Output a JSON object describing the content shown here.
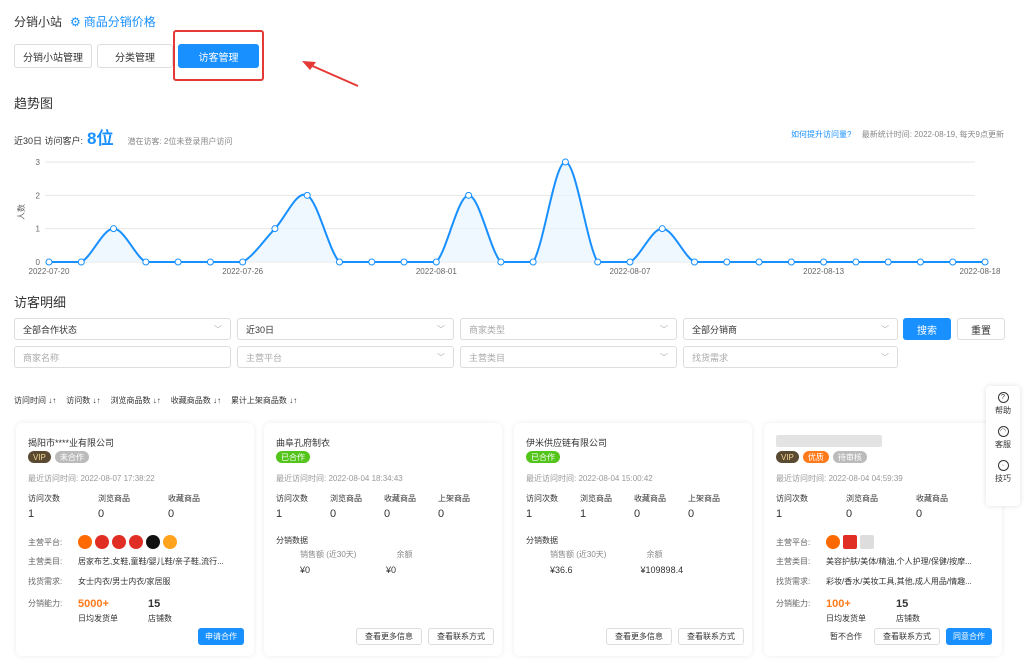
{
  "header": {
    "site": "分销小站",
    "price_link": "商品分销价格"
  },
  "tabs": [
    {
      "label": "分销小站管理"
    },
    {
      "label": "分类管理"
    },
    {
      "label": "访客管理"
    }
  ],
  "trend": {
    "title": "趋势图",
    "summary_label": "近30日 访问客户:",
    "summary_value": "8位",
    "potential": "潜在访客: 2位未登录用户访问",
    "help_link": "如何提升访问量?",
    "updated": "最新统计时间: 2022-08-19, 每天9点更新"
  },
  "chart_data": {
    "type": "area",
    "ylabel": "人数",
    "ylim": [
      0,
      3
    ],
    "yticks": [
      "0",
      "1",
      "2",
      "3"
    ],
    "x": [
      "2022-07-20",
      "2022-07-21",
      "2022-07-22",
      "2022-07-23",
      "2022-07-24",
      "2022-07-25",
      "2022-07-26",
      "2022-07-27",
      "2022-07-28",
      "2022-07-29",
      "2022-07-30",
      "2022-07-31",
      "2022-08-01",
      "2022-08-02",
      "2022-08-03",
      "2022-08-04",
      "2022-08-05",
      "2022-08-06",
      "2022-08-07",
      "2022-08-08",
      "2022-08-09",
      "2022-08-10",
      "2022-08-11",
      "2022-08-12",
      "2022-08-13",
      "2022-08-14",
      "2022-08-15",
      "2022-08-16",
      "2022-08-17",
      "2022-08-18"
    ],
    "xticks": [
      "2022-07-20",
      "2022-07-26",
      "2022-08-01",
      "2022-08-07",
      "2022-08-13",
      "2022-08-18"
    ],
    "values": [
      0,
      0,
      1,
      0,
      0,
      0,
      0,
      1,
      2,
      0,
      0,
      0,
      0,
      2,
      0,
      0,
      3,
      0,
      0,
      1,
      0,
      0,
      0,
      0,
      0,
      0,
      0,
      0,
      0,
      0
    ],
    "line_color": "#1890ff"
  },
  "detail": {
    "title": "访客明细"
  },
  "filters": {
    "row1": [
      "全部合作状态",
      "近30日",
      "商家类型",
      "全部分销商"
    ],
    "row2": [
      "商家名称",
      "主营平台",
      "主营类目",
      "找货需求"
    ],
    "search": "搜索",
    "reset": "重置"
  },
  "sorts": [
    "访问时间",
    "访问数",
    "浏览商品数",
    "收藏商品数",
    "累计上架商品数"
  ],
  "sidebar": [
    "帮助",
    "客服",
    "技巧"
  ],
  "cards": [
    {
      "name": "揭阳市****业有限公司",
      "badges": [
        "VIP",
        "未合作"
      ],
      "visit": "最近访问时间: 2022-08-07 17:38:22",
      "metric_labels": [
        "访问次数",
        "浏览商品",
        "收藏商品"
      ],
      "metric_values": [
        "1",
        "0",
        "0"
      ],
      "platform_label": "主营平台:",
      "category_label": "主营类目:",
      "category": "居家布艺,女鞋,童鞋/婴儿鞋/亲子鞋,流行...",
      "demand_label": "找货需求:",
      "demand": "女士内衣/男士内衣/家居服",
      "cap_label": "分销能力:",
      "cap1": "5000+",
      "cap1_unit": "日均发货单",
      "cap2": "15",
      "cap2_unit": "店铺数",
      "btn": "申请合作"
    },
    {
      "name": "曲阜孔府制衣",
      "badges": [
        "已合作"
      ],
      "visit": "最近访问时间: 2022-08-04 18:34:43",
      "metric_labels": [
        "访问次数",
        "浏览商品",
        "收藏商品",
        "上架商品"
      ],
      "metric_values": [
        "1",
        "0",
        "0",
        "0"
      ],
      "fx_title": "分销数据",
      "fx_col1": "销售额 (近30天)",
      "fx_col2": "余额",
      "fx_val1": "¥0",
      "fx_val2": "¥0",
      "btn1": "查看更多信息",
      "btn2": "查看联系方式"
    },
    {
      "name": "伊米供应链有限公司",
      "badges": [
        "已合作"
      ],
      "visit": "最近访问时间: 2022-08-04 15:00:42",
      "metric_labels": [
        "访问次数",
        "浏览商品",
        "收藏商品",
        "上架商品"
      ],
      "metric_values": [
        "1",
        "1",
        "0",
        "0"
      ],
      "fx_title": "分销数据",
      "fx_col1": "销售额 (近30天)",
      "fx_col2": "余额",
      "fx_val1": "¥36.6",
      "fx_val2": "¥109898.4",
      "btn1": "查看更多信息",
      "btn2": "查看联系方式"
    },
    {
      "badges": [
        "VIP",
        "优质",
        "待审核"
      ],
      "visit": "最近访问时间: 2022-08-04 04:59:39",
      "metric_labels": [
        "访问次数",
        "浏览商品",
        "收藏商品"
      ],
      "metric_values": [
        "1",
        "0",
        "0"
      ],
      "platform_label": "主营平台:",
      "category_label": "主营类目:",
      "category": "美容护肤/美体/精油,个人护理/保健/按摩...",
      "demand_label": "找货需求:",
      "demand": "彩妆/香水/美妆工具,其他,成人用品/情趣...",
      "cap_label": "分销能力:",
      "cap1": "100+",
      "cap1_unit": "日均发货单",
      "cap2": "15",
      "cap2_unit": "店铺数",
      "btn1": "暂不合作",
      "btn2": "查看联系方式",
      "btn3": "同意合作"
    }
  ]
}
